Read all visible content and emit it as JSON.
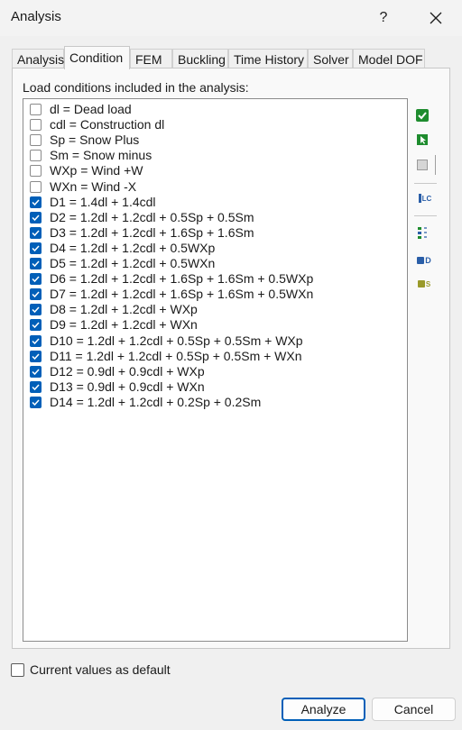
{
  "window": {
    "title": "Analysis",
    "help_label": "?",
    "close_icon": "close-icon"
  },
  "tabs": [
    {
      "label": "Analysis",
      "active": false
    },
    {
      "label": "Condition",
      "active": true
    },
    {
      "label": "FEM",
      "active": false
    },
    {
      "label": "Buckling",
      "active": false
    },
    {
      "label": "Time History",
      "active": false
    },
    {
      "label": "Solver",
      "active": false
    },
    {
      "label": "Model DOF",
      "active": false
    }
  ],
  "condition": {
    "group_label": "Load conditions included in the analysis:",
    "items": [
      {
        "label": "dl = Dead load",
        "checked": false
      },
      {
        "label": "cdl = Construction dl",
        "checked": false
      },
      {
        "label": "Sp = Snow Plus",
        "checked": false
      },
      {
        "label": "Sm = Snow minus",
        "checked": false
      },
      {
        "label": "WXp = Wind +W",
        "checked": false
      },
      {
        "label": "WXn = Wind -X",
        "checked": false
      },
      {
        "label": "D1 = 1.4dl + 1.4cdl",
        "checked": true
      },
      {
        "label": "D2 = 1.2dl + 1.2cdl + 0.5Sp + 0.5Sm",
        "checked": true
      },
      {
        "label": "D3 = 1.2dl + 1.2cdl + 1.6Sp + 1.6Sm",
        "checked": true
      },
      {
        "label": "D4 = 1.2dl + 1.2cdl + 0.5WXp",
        "checked": true
      },
      {
        "label": "D5 = 1.2dl + 1.2cdl + 0.5WXn",
        "checked": true
      },
      {
        "label": "D6 = 1.2dl + 1.2cdl + 1.6Sp + 1.6Sm + 0.5WXp",
        "checked": true
      },
      {
        "label": "D7 = 1.2dl + 1.2cdl + 1.6Sp + 1.6Sm + 0.5WXn",
        "checked": true
      },
      {
        "label": "D8 = 1.2dl + 1.2cdl + WXp",
        "checked": true
      },
      {
        "label": "D9 = 1.2dl + 1.2cdl + WXn",
        "checked": true
      },
      {
        "label": "D10 = 1.2dl + 1.2cdl + 0.5Sp + 0.5Sm + WXp",
        "checked": true
      },
      {
        "label": "D11 = 1.2dl + 1.2cdl + 0.5Sp + 0.5Sm + WXn",
        "checked": true
      },
      {
        "label": "D12 = 0.9dl + 0.9cdl + WXp",
        "checked": true
      },
      {
        "label": "D13 = 0.9dl + 0.9cdl + WXn",
        "checked": true
      },
      {
        "label": "D14 = 1.2dl + 1.2cdl + 0.2Sp + 0.2Sm",
        "checked": true
      }
    ]
  },
  "side_tools": {
    "check_all_icon": "check-all-icon",
    "select_icon": "select-icon",
    "uncheck_all_icon": "uncheck-all-icon",
    "lc_icon": "load-case-icon",
    "lc_text": "LC",
    "sort_icon": "sort-icon",
    "design_icon": "design-icon",
    "design_text": "D",
    "service_icon": "service-icon",
    "service_text": "S"
  },
  "footer": {
    "default_label": "Current values as default",
    "default_checked": false,
    "analyze_label": "Analyze",
    "cancel_label": "Cancel"
  },
  "colors": {
    "accent": "#005fb8",
    "tool_green": "#1e8c2e",
    "tool_blue": "#2a5ea8",
    "tool_olive": "#9a9a2a"
  }
}
